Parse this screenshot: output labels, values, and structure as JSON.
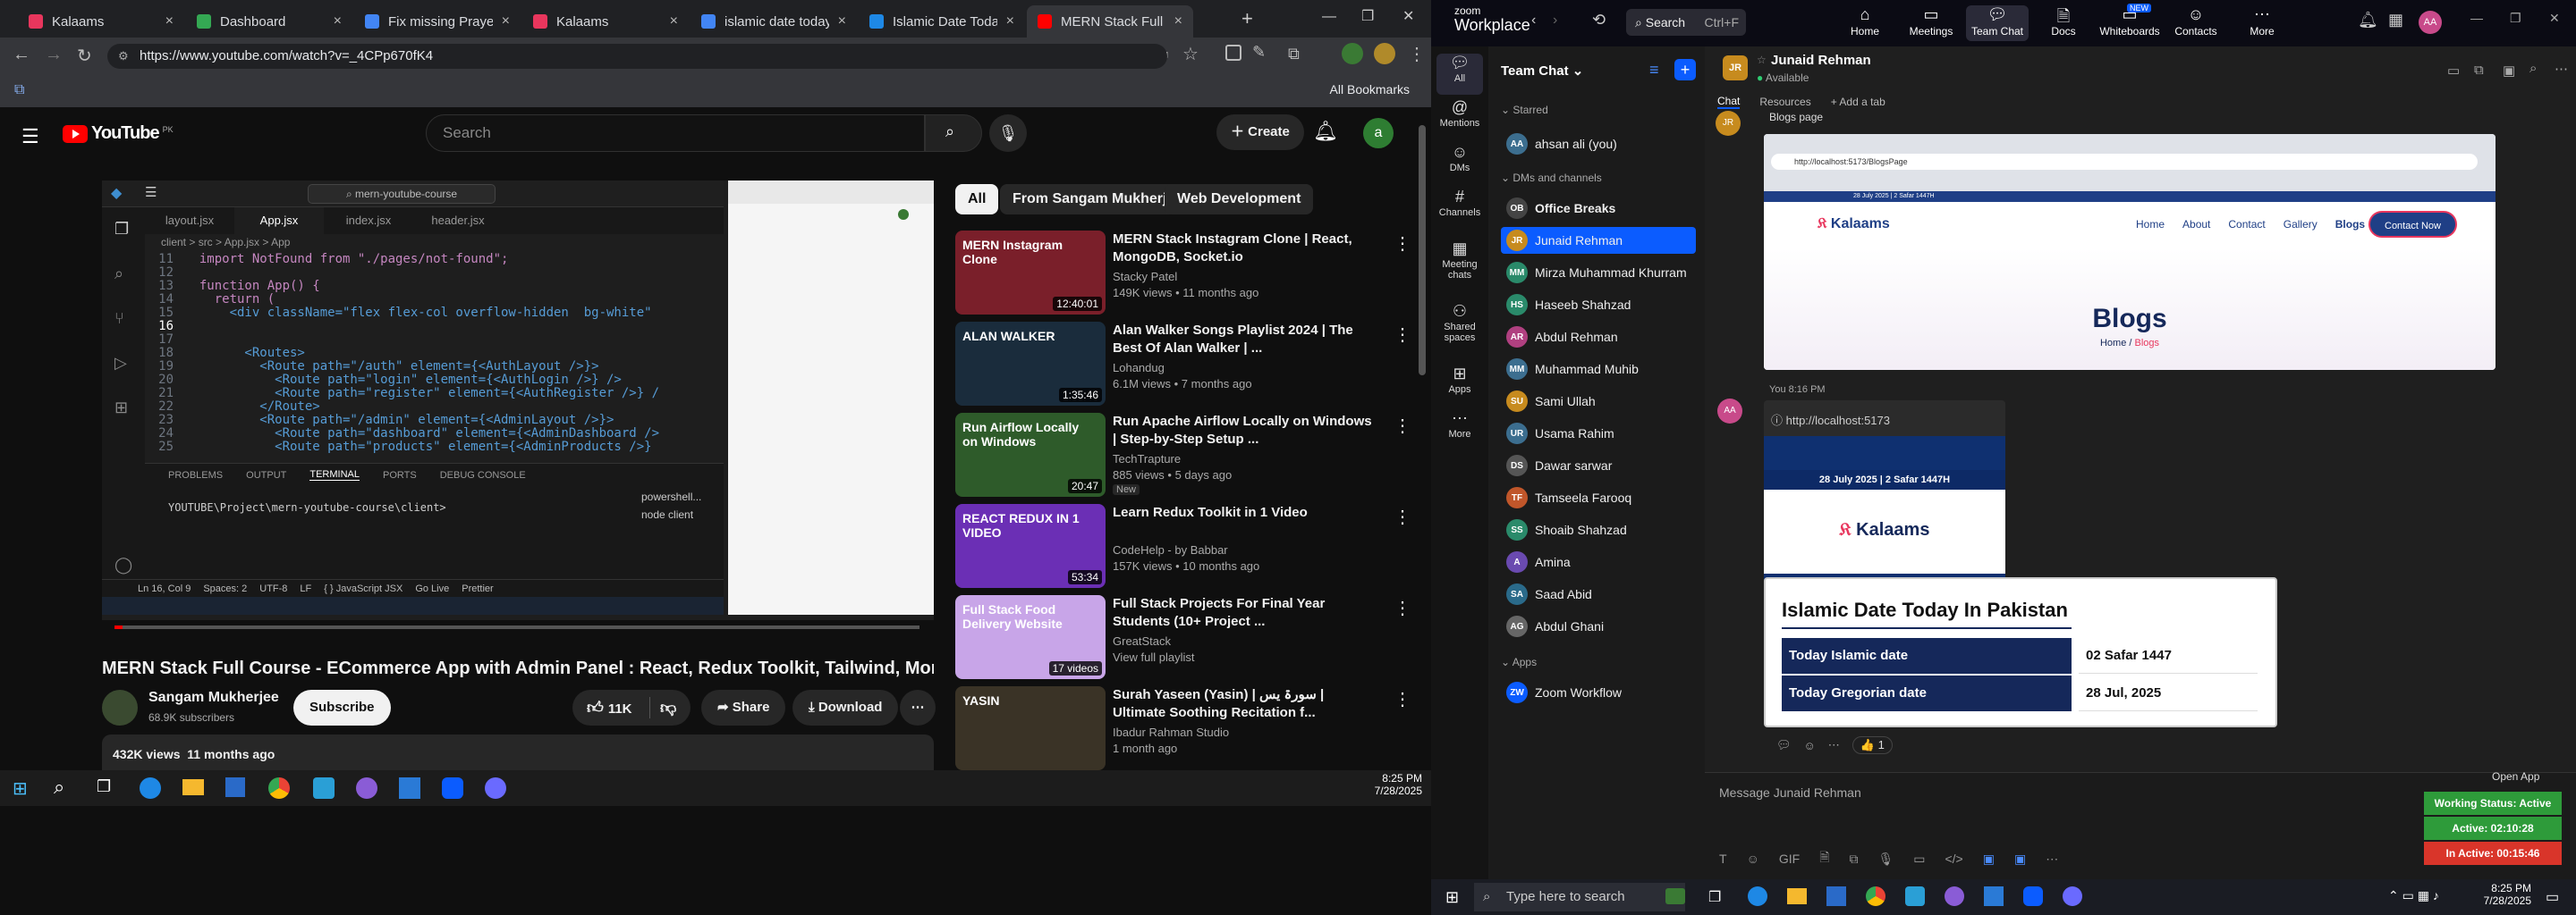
{
  "chrome": {
    "tabs": [
      {
        "label": "Kalaams",
        "color": "#e8365d"
      },
      {
        "label": "Dashboard",
        "color": "#34a853"
      },
      {
        "label": "Fix missing PrayerTime",
        "color": "#4285f4"
      },
      {
        "label": "Kalaams",
        "color": "#e8365d"
      },
      {
        "label": "islamic date today ne",
        "color": "#4285f4"
      },
      {
        "label": "Islamic Date Today - I",
        "color": "#1e88e5"
      },
      {
        "label": "MERN Stack Full Cours",
        "color": "#ff0000"
      }
    ],
    "new_tab": "+",
    "url": "https://www.youtube.com/watch?v=_4CPp670fK4",
    "all_bookmarks": "All Bookmarks",
    "window_controls": {
      "minimize": "—",
      "maximize": "❐",
      "close": "✕"
    }
  },
  "youtube": {
    "logo": "YouTube",
    "country": "PK",
    "search_placeholder": "Search",
    "create": "Create",
    "avatar": "a",
    "chips": [
      "All",
      "From Sangam Mukherjee",
      "Web Development"
    ],
    "video_title": "MERN Stack Full Course - ECommerce App with Admin Panel : React, Redux Toolkit, Tailwind, MongoDB",
    "channel": "Sangam Mukherjee",
    "subscribers": "68.9K subscribers",
    "subscribe": "Subscribe",
    "likes": "11K",
    "share": "Share",
    "download": "Download",
    "views": "432K views",
    "age": "11 months ago",
    "recommendations": [
      {
        "title": "MERN Stack Instagram Clone | React, MongoDB, Socket.io",
        "channel": "Stacky Patel",
        "meta": "149K views • 11 months ago",
        "duration": "12:40:01",
        "thumb": "#7a1f2a",
        "thumb_text": "MERN Instagram Clone"
      },
      {
        "title": "Alan Walker Songs Playlist 2024 | The Best Of Alan Walker | ...",
        "channel": "Lohandug",
        "meta": "6.1M views • 7 months ago",
        "duration": "1:35:46",
        "thumb": "#1a2c3c",
        "thumb_text": "ALAN WALKER"
      },
      {
        "title": "Run Apache Airflow Locally on Windows | Step-by-Step Setup ...",
        "channel": "TechTrapture",
        "meta": "885 views • 5 days ago",
        "badge": "New",
        "duration": "20:47",
        "thumb": "#2e5b2a",
        "thumb_text": "Run Airflow Locally on Windows"
      },
      {
        "title": "Learn Redux Toolkit in 1 Video",
        "channel": "CodeHelp - by Babbar",
        "meta": "157K views • 10 months ago",
        "duration": "53:34",
        "thumb": "#6b2fb5",
        "thumb_text": "REACT REDUX IN 1 VIDEO"
      },
      {
        "title": "Full Stack Projects For Final Year Students (10+ Project ...",
        "channel": "GreatStack",
        "meta": "View full playlist",
        "duration": "17 videos",
        "thumb": "#c8a5e8",
        "thumb_text": "Full Stack Food Delivery Website"
      },
      {
        "title": "Surah Yaseen (Yasin) | سورۃ یس | Ultimate Soothing Recitation f...",
        "channel": "Ibadur Rahman Studio",
        "meta": "1 month ago",
        "duration": "",
        "thumb": "#3a3326",
        "thumb_text": "YASIN"
      }
    ]
  },
  "vscode": {
    "search": "mern-youtube-course",
    "tabs": [
      "layout.jsx",
      "App.jsx",
      "index.jsx",
      "header.jsx"
    ],
    "breadcrumb": "client > src > App.jsx > App",
    "lines": [
      {
        "n": "11",
        "t": "  import NotFound from \"./pages/not-found\";"
      },
      {
        "n": "12",
        "t": ""
      },
      {
        "n": "13",
        "t": "  function App() {"
      },
      {
        "n": "14",
        "t": "    return ("
      },
      {
        "n": "15",
        "t": "      <div className=\"flex flex-col overflow-hidden  bg-white\""
      },
      {
        "n": "16",
        "t": ""
      },
      {
        "n": "17",
        "t": ""
      },
      {
        "n": "18",
        "t": "        <Routes>"
      },
      {
        "n": "19",
        "t": "          <Route path=\"/auth\" element={<AuthLayout />}>"
      },
      {
        "n": "20",
        "t": "            <Route path=\"login\" element={<AuthLogin />} />"
      },
      {
        "n": "21",
        "t": "            <Route path=\"register\" element={<AuthRegister />} /"
      },
      {
        "n": "22",
        "t": "          </Route>"
      },
      {
        "n": "23",
        "t": "          <Route path=\"/admin\" element={<AdminLayout />}>"
      },
      {
        "n": "24",
        "t": "            <Route path=\"dashboard\" element={<AdminDashboard />"
      },
      {
        "n": "25",
        "t": "            <Route path=\"products\" element={<AdminProducts />}"
      }
    ],
    "panel_tabs": [
      "PROBLEMS",
      "OUTPUT",
      "TERMINAL",
      "PORTS",
      "DEBUG CONSOLE"
    ],
    "terminal": "YOUTUBE\\Project\\mern-youtube-course\\client> ",
    "terminals": [
      "powershell...",
      "node  client"
    ],
    "status": [
      "Ln 16, Col 9",
      "Spaces: 2",
      "UTF-8",
      "LF",
      "{ } JavaScript JSX",
      "Go Live",
      "Prettier"
    ]
  },
  "taskbar_left": {
    "time": "8:25 PM",
    "date": "7/28/2025"
  },
  "teams": {
    "brand_top": "zoom",
    "brand": "Workplace",
    "search": "Search",
    "shortcut": "Ctrl+F",
    "nav": [
      "Home",
      "Meetings",
      "Team Chat",
      "Docs",
      "Whiteboards",
      "Contacts",
      "More"
    ],
    "new_badge": "NEW",
    "rail": [
      "All",
      "Mentions",
      "DMs",
      "Channels",
      "Meeting chats",
      "Shared spaces",
      "Apps",
      "More"
    ],
    "panel_title": "Team Chat",
    "sections": {
      "starred": "Starred",
      "dms": "DMs and channels",
      "apps": "Apps"
    },
    "starred": [
      {
        "name": "ahsan ali (you)",
        "init": "AA",
        "color": "#3c6e8f"
      }
    ],
    "dms": [
      {
        "name": "Office Breaks",
        "init": "OB",
        "color": "#444"
      },
      {
        "name": "Junaid Rehman",
        "init": "JR",
        "color": "#c78b1e"
      },
      {
        "name": "Mirza Muhammad Khurram",
        "init": "MM",
        "color": "#2a8a6a"
      },
      {
        "name": "Haseeb Shahzad",
        "init": "HS",
        "color": "#2a8a6a"
      },
      {
        "name": "Abdul Rehman",
        "init": "AR",
        "color": "#b04080"
      },
      {
        "name": "Muhammad Muhib",
        "init": "MM",
        "color": "#3c6e8f"
      },
      {
        "name": "Sami Ullah",
        "init": "SU",
        "color": "#c78b1e"
      },
      {
        "name": "Usama Rahim",
        "init": "UR",
        "color": "#3c6e8f"
      },
      {
        "name": "Dawar sarwar",
        "init": "DS",
        "color": "#555"
      },
      {
        "name": "Tamseela Farooq",
        "init": "TF",
        "color": "#c0562a"
      },
      {
        "name": "Shoaib Shahzad",
        "init": "SS",
        "color": "#2a8a6a"
      },
      {
        "name": "Amina",
        "init": "A",
        "color": "#6a4ab0"
      },
      {
        "name": "Saad Abid",
        "init": "SA",
        "color": "#2a6a8a"
      },
      {
        "name": "Abdul Ghani",
        "init": "AG",
        "color": "#666"
      }
    ],
    "apps": [
      {
        "name": "Zoom Workflow",
        "init": "ZW",
        "color": "#0b5cff"
      }
    ],
    "contact": {
      "name": "Junaid Rehman",
      "status": "Available",
      "init": "JR"
    },
    "conv_tabs": [
      "Chat",
      "Resources",
      "+ Add a tab"
    ],
    "self_time": "You 8:16 PM",
    "self_init": "AA",
    "link": "http://localhost:5173",
    "prev_caption": "Blogs page",
    "blog": {
      "url": "http://localhost:5173/BlogsPage",
      "nav": [
        "Home",
        "About",
        "Contact",
        "Gallery",
        "Blogs"
      ],
      "contact_btn": "Contact Now",
      "brand": "Kalaams",
      "heading": "Blogs",
      "crumb_home": "Home",
      "crumb_cur": "Blogs",
      "topstrip": "28 July 2025 | 2 Safar 1447H"
    },
    "preview_strip": "28 July 2025 | 2 Safar 1447H",
    "preview_brand": "Kalaams",
    "islamic": {
      "title": "Islamic Date Today In Pakistan",
      "rows": [
        {
          "label": "Today Islamic date",
          "value": "02 Safar 1447"
        },
        {
          "label": "Today Gregorian date",
          "value": "28 Jul, 2025"
        }
      ]
    },
    "reaction_count": "1",
    "message_placeholder": "Message Junaid Rehman",
    "open_app": "Open App",
    "status_widget": [
      {
        "text": "Working Status: Active",
        "color": "#2e9b3a"
      },
      {
        "text": "Active: 02:10:28",
        "color": "#2e9b3a"
      },
      {
        "text": "In Active: 00:15:46",
        "color": "#d9352a"
      }
    ]
  },
  "taskbar_right": {
    "search": "Type here to search",
    "time": "8:25 PM",
    "date": "7/28/2025"
  }
}
